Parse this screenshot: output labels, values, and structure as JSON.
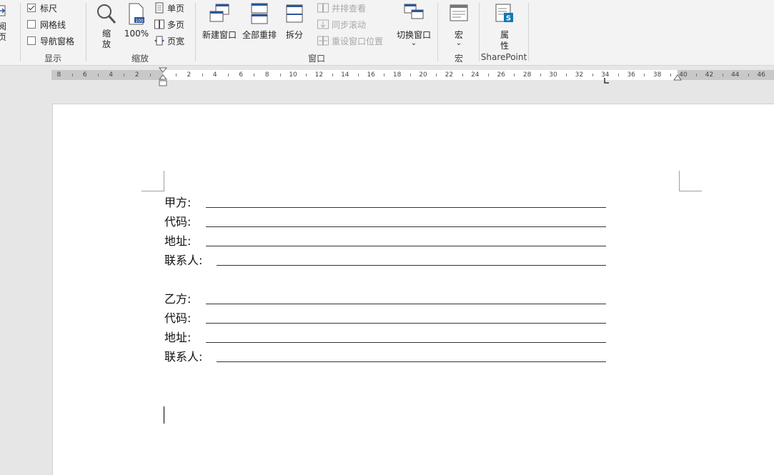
{
  "ribbon": {
    "left_cut": {
      "line1": "阅",
      "line2": "页"
    },
    "show": {
      "label": "显示",
      "items": [
        {
          "label": "标尺",
          "checked": true
        },
        {
          "label": "网格线",
          "checked": false
        },
        {
          "label": "导航窗格",
          "checked": false
        }
      ]
    },
    "zoom": {
      "label": "缩放",
      "zoom_btn": {
        "line1": "缩",
        "line2": "放"
      },
      "hundred_btn": "100%",
      "one_page": "单页",
      "multi_page": "多页",
      "page_width": "页宽"
    },
    "window": {
      "label": "窗口",
      "new_window": "新建窗口",
      "arrange_all": "全部重排",
      "split": "拆分",
      "side_by_side": "并排查看",
      "sync_scroll": "同步滚动",
      "reset_position": "重设窗口位置",
      "switch_window": "切换窗口",
      "switch_arrow": "⌄"
    },
    "macro": {
      "label": "宏",
      "button": "宏",
      "arrow": "⌄"
    },
    "sharepoint": {
      "label": "SharePoint",
      "props": {
        "line1": "属",
        "line2": "性"
      }
    }
  },
  "ruler": {
    "left_numbers": [
      "8",
      "6",
      "4",
      "2"
    ],
    "right_numbers": [
      "2",
      "4",
      "6",
      "8",
      "10",
      "12",
      "14",
      "16",
      "18",
      "20",
      "22",
      "24",
      "26",
      "28",
      "30",
      "32",
      "34",
      "36",
      "38"
    ],
    "far_numbers": [
      "40",
      "42",
      "44",
      "46"
    ]
  },
  "document": {
    "lines": [
      {
        "label": "甲方:"
      },
      {
        "label": "代码:"
      },
      {
        "label": "地址:"
      },
      {
        "label": "联系人:"
      },
      {
        "label": "乙方:"
      },
      {
        "label": "代码:"
      },
      {
        "label": "地址:"
      },
      {
        "label": "联系人:"
      }
    ]
  },
  "colors": {
    "accent": "#2b579a",
    "ribbon_bg": "#f3f3f3",
    "canvas_bg": "#e6e6e6"
  }
}
